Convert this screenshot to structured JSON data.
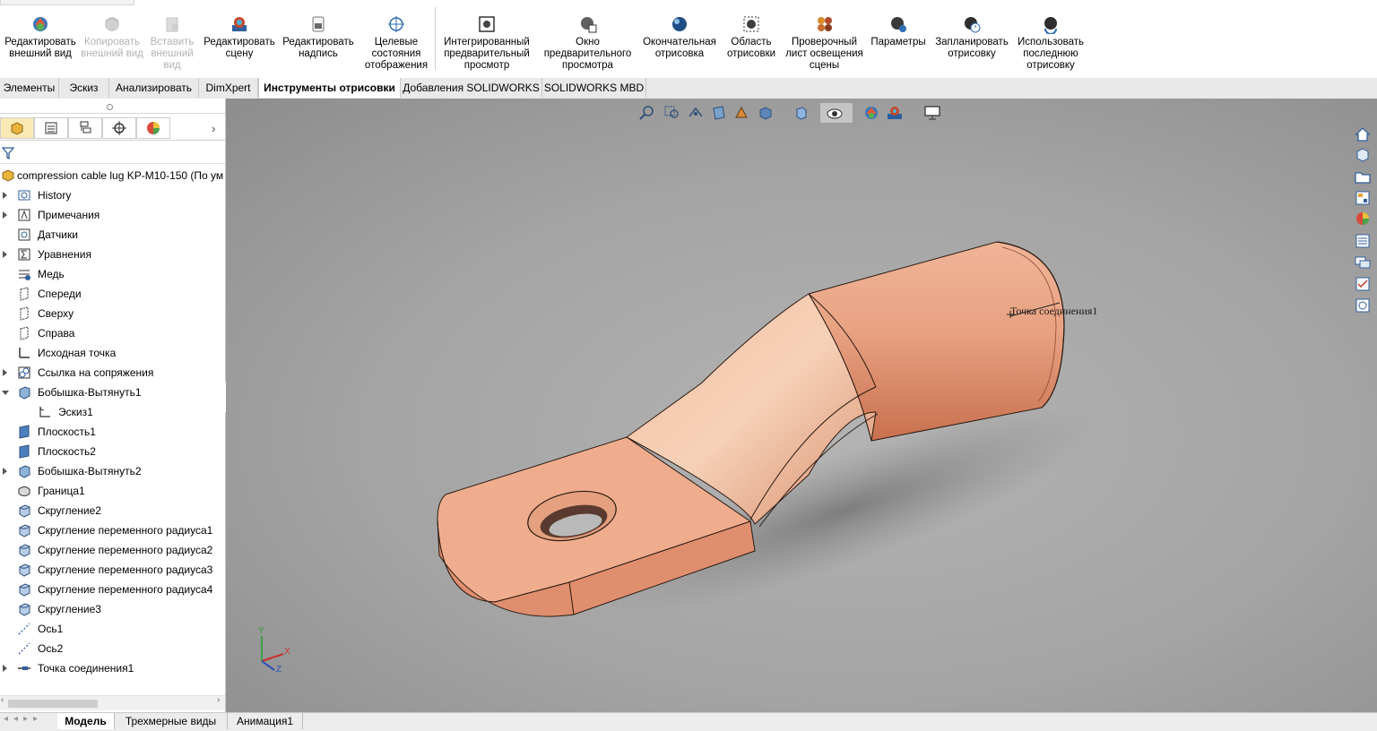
{
  "ribbon": {
    "buttons": [
      {
        "label": "Редактировать внешний вид",
        "icon": "edit-appearance-icon",
        "enabled": true
      },
      {
        "label": "Копировать внешний вид",
        "icon": "copy-appearance-icon",
        "enabled": false
      },
      {
        "label": "Вставить внешний вид",
        "icon": "paste-appearance-icon",
        "enabled": false
      },
      {
        "label": "Редактировать сцену",
        "icon": "edit-scene-icon",
        "enabled": true
      },
      {
        "label": "Редактировать надпись",
        "icon": "edit-decal-icon",
        "enabled": true
      },
      {
        "label": "Целевые состояния отображения",
        "icon": "target-display-states-icon",
        "enabled": true
      },
      {
        "label": "Интегрированный предварительный просмотр",
        "icon": "integrated-preview-icon",
        "enabled": true
      },
      {
        "label": "Окно предварительного просмотра",
        "icon": "preview-window-icon",
        "enabled": true
      },
      {
        "label": "Окончательная отрисовка",
        "icon": "final-render-icon",
        "enabled": true
      },
      {
        "label": "Область отрисовки",
        "icon": "render-region-icon",
        "enabled": true
      },
      {
        "label": "Проверочный лист освещения сцены",
        "icon": "scene-illumination-proof-sheet-icon",
        "enabled": true
      },
      {
        "label": "Параметры",
        "icon": "options-icon",
        "enabled": true
      },
      {
        "label": "Запланировать отрисовку",
        "icon": "schedule-render-icon",
        "enabled": true
      },
      {
        "label": "Использовать последнюю отрисовку",
        "icon": "recall-last-render-icon",
        "enabled": true
      }
    ]
  },
  "tabs": [
    "Элементы",
    "Эскиз",
    "Анализировать",
    "DimXpert",
    "Инструменты отрисовки",
    "Добавления SOLIDWORKS",
    "SOLIDWORKS MBD"
  ],
  "active_tab": "Инструменты отрисовки",
  "tree": {
    "root": "compression cable lug KP-M10-150  (По ум",
    "items": [
      {
        "label": "History",
        "icon": "history-icon",
        "expander": "collapsed"
      },
      {
        "label": "Примечания",
        "icon": "annotations-icon",
        "expander": "collapsed"
      },
      {
        "label": "Датчики",
        "icon": "sensors-icon",
        "expander": "none"
      },
      {
        "label": "Уравнения",
        "icon": "equations-icon",
        "expander": "collapsed"
      },
      {
        "label": "Медь",
        "icon": "material-icon",
        "expander": "none"
      },
      {
        "label": "Спереди",
        "icon": "plane-icon",
        "expander": "none"
      },
      {
        "label": "Сверху",
        "icon": "plane-icon",
        "expander": "none"
      },
      {
        "label": "Справа",
        "icon": "plane-icon",
        "expander": "none"
      },
      {
        "label": "Исходная точка",
        "icon": "origin-icon",
        "expander": "none"
      },
      {
        "label": "Ссылка на сопряжения",
        "icon": "mate-reference-icon",
        "expander": "collapsed"
      },
      {
        "label": "Бобышка-Вытянуть1",
        "icon": "extrude-icon",
        "expander": "expanded"
      },
      {
        "label": "Эскиз1",
        "icon": "sketch-icon",
        "expander": "none",
        "indent": true
      },
      {
        "label": "Плоскость1",
        "icon": "ref-plane-icon",
        "expander": "none"
      },
      {
        "label": "Плоскость2",
        "icon": "ref-plane-icon",
        "expander": "none"
      },
      {
        "label": "Бобышка-Вытянуть2",
        "icon": "extrude-icon",
        "expander": "collapsed"
      },
      {
        "label": "Граница1",
        "icon": "boundary-icon",
        "expander": "none"
      },
      {
        "label": "Скругление2",
        "icon": "fillet-icon",
        "expander": "none"
      },
      {
        "label": "Скругление переменного радиуса1",
        "icon": "fillet-icon",
        "expander": "none"
      },
      {
        "label": "Скругление переменного радиуса2",
        "icon": "fillet-icon",
        "expander": "none"
      },
      {
        "label": "Скругление переменного радиуса3",
        "icon": "fillet-icon",
        "expander": "none"
      },
      {
        "label": "Скругление переменного радиуса4",
        "icon": "fillet-icon",
        "expander": "none"
      },
      {
        "label": "Скругление3",
        "icon": "fillet-icon",
        "expander": "none"
      },
      {
        "label": "Ось1",
        "icon": "axis-icon",
        "expander": "none"
      },
      {
        "label": "Ось2",
        "icon": "axis-icon",
        "expander": "none"
      },
      {
        "label": "Точка соединения1",
        "icon": "connection-point-icon",
        "expander": "collapsed"
      }
    ]
  },
  "viewport": {
    "annotation": "Точка соединения1",
    "triad": {
      "x": "X",
      "y": "Y",
      "z": "Z"
    }
  },
  "bottom_tabs": [
    "Модель",
    "Трехмерные виды",
    "Анимация1"
  ],
  "active_bottom_tab": "Модель",
  "colors": {
    "copper": "#e9a88a",
    "viewport_bg": "#a8a8a8",
    "active_panel_tab": "#fbe9b4"
  }
}
